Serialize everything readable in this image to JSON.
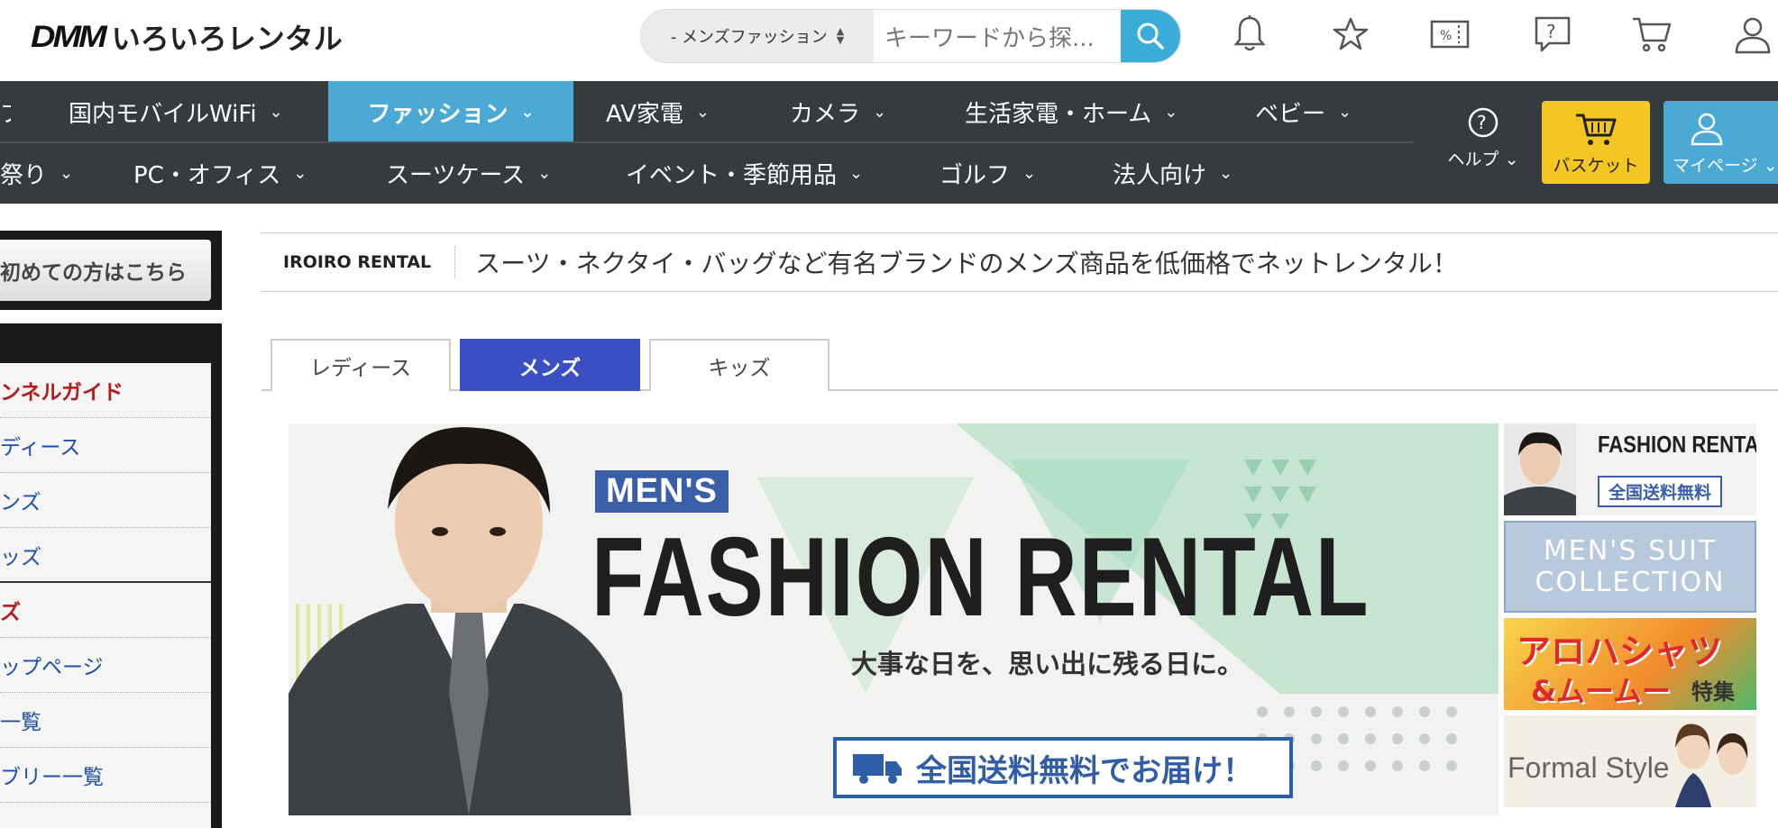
{
  "header": {
    "logo_mark": "DMM",
    "logo_service": "いろいろレンタル",
    "search": {
      "category": "- メンズファッション",
      "placeholder": "キーワードから探..."
    },
    "icons": [
      "bell-icon",
      "star-icon",
      "coupon-icon",
      "help-chat-icon",
      "cart-icon",
      "user-icon"
    ]
  },
  "nav": {
    "row1": [
      {
        "label": "プ"
      },
      {
        "label": "国内モバイルWiFi"
      },
      {
        "label": "ファッション",
        "active": true
      },
      {
        "label": "AV家電"
      },
      {
        "label": "カメラ"
      },
      {
        "label": "生活家電・ホーム"
      },
      {
        "label": "ベビー"
      }
    ],
    "row2": [
      {
        "label": "祭り"
      },
      {
        "label": "PC・オフィス"
      },
      {
        "label": "スーツケース"
      },
      {
        "label": "イベント・季節用品"
      },
      {
        "label": "ゴルフ"
      },
      {
        "label": "法人向け"
      }
    ],
    "help_label": "ヘルプ",
    "basket_label": "バスケット",
    "mypage_label": "マイページ",
    "accent": "#4aaad5",
    "basket_color": "#f4c622"
  },
  "sidebar": {
    "first_time": "初めての方はこちら",
    "items": [
      {
        "label": "ンネルガイド",
        "style": "red"
      },
      {
        "label": "ディース"
      },
      {
        "label": "ンズ"
      },
      {
        "label": "ッズ",
        "style": "block"
      },
      {
        "label": "ズ",
        "style": "red"
      },
      {
        "label": "ップページ"
      },
      {
        "label": "一覧"
      },
      {
        "label": "ブリー一覧"
      }
    ]
  },
  "main": {
    "brand": "IROIRO RENTAL",
    "description": "スーツ・ネクタイ・バッグなど有名ブランドのメンズ商品を低価格でネットレンタル！",
    "tabs": [
      {
        "label": "レディース"
      },
      {
        "label": "メンズ",
        "active": true
      },
      {
        "label": "キッズ"
      }
    ],
    "banner": {
      "tag": "MEN'S",
      "title": "FASHION RENTAL",
      "subtitle": "大事な日を、思い出に残る日に。",
      "shipping": "全国送料無料でお届け！"
    },
    "side_banners": [
      {
        "title": "FASHION RENTAL",
        "sub": "全国送料無料"
      },
      {
        "line1": "MEN'S SUIT",
        "line2": "COLLECTION"
      },
      {
        "line1": "アロハシャツ",
        "line2": "&ムームー",
        "line3": "特集"
      },
      {
        "title": "Formal Style"
      }
    ]
  }
}
